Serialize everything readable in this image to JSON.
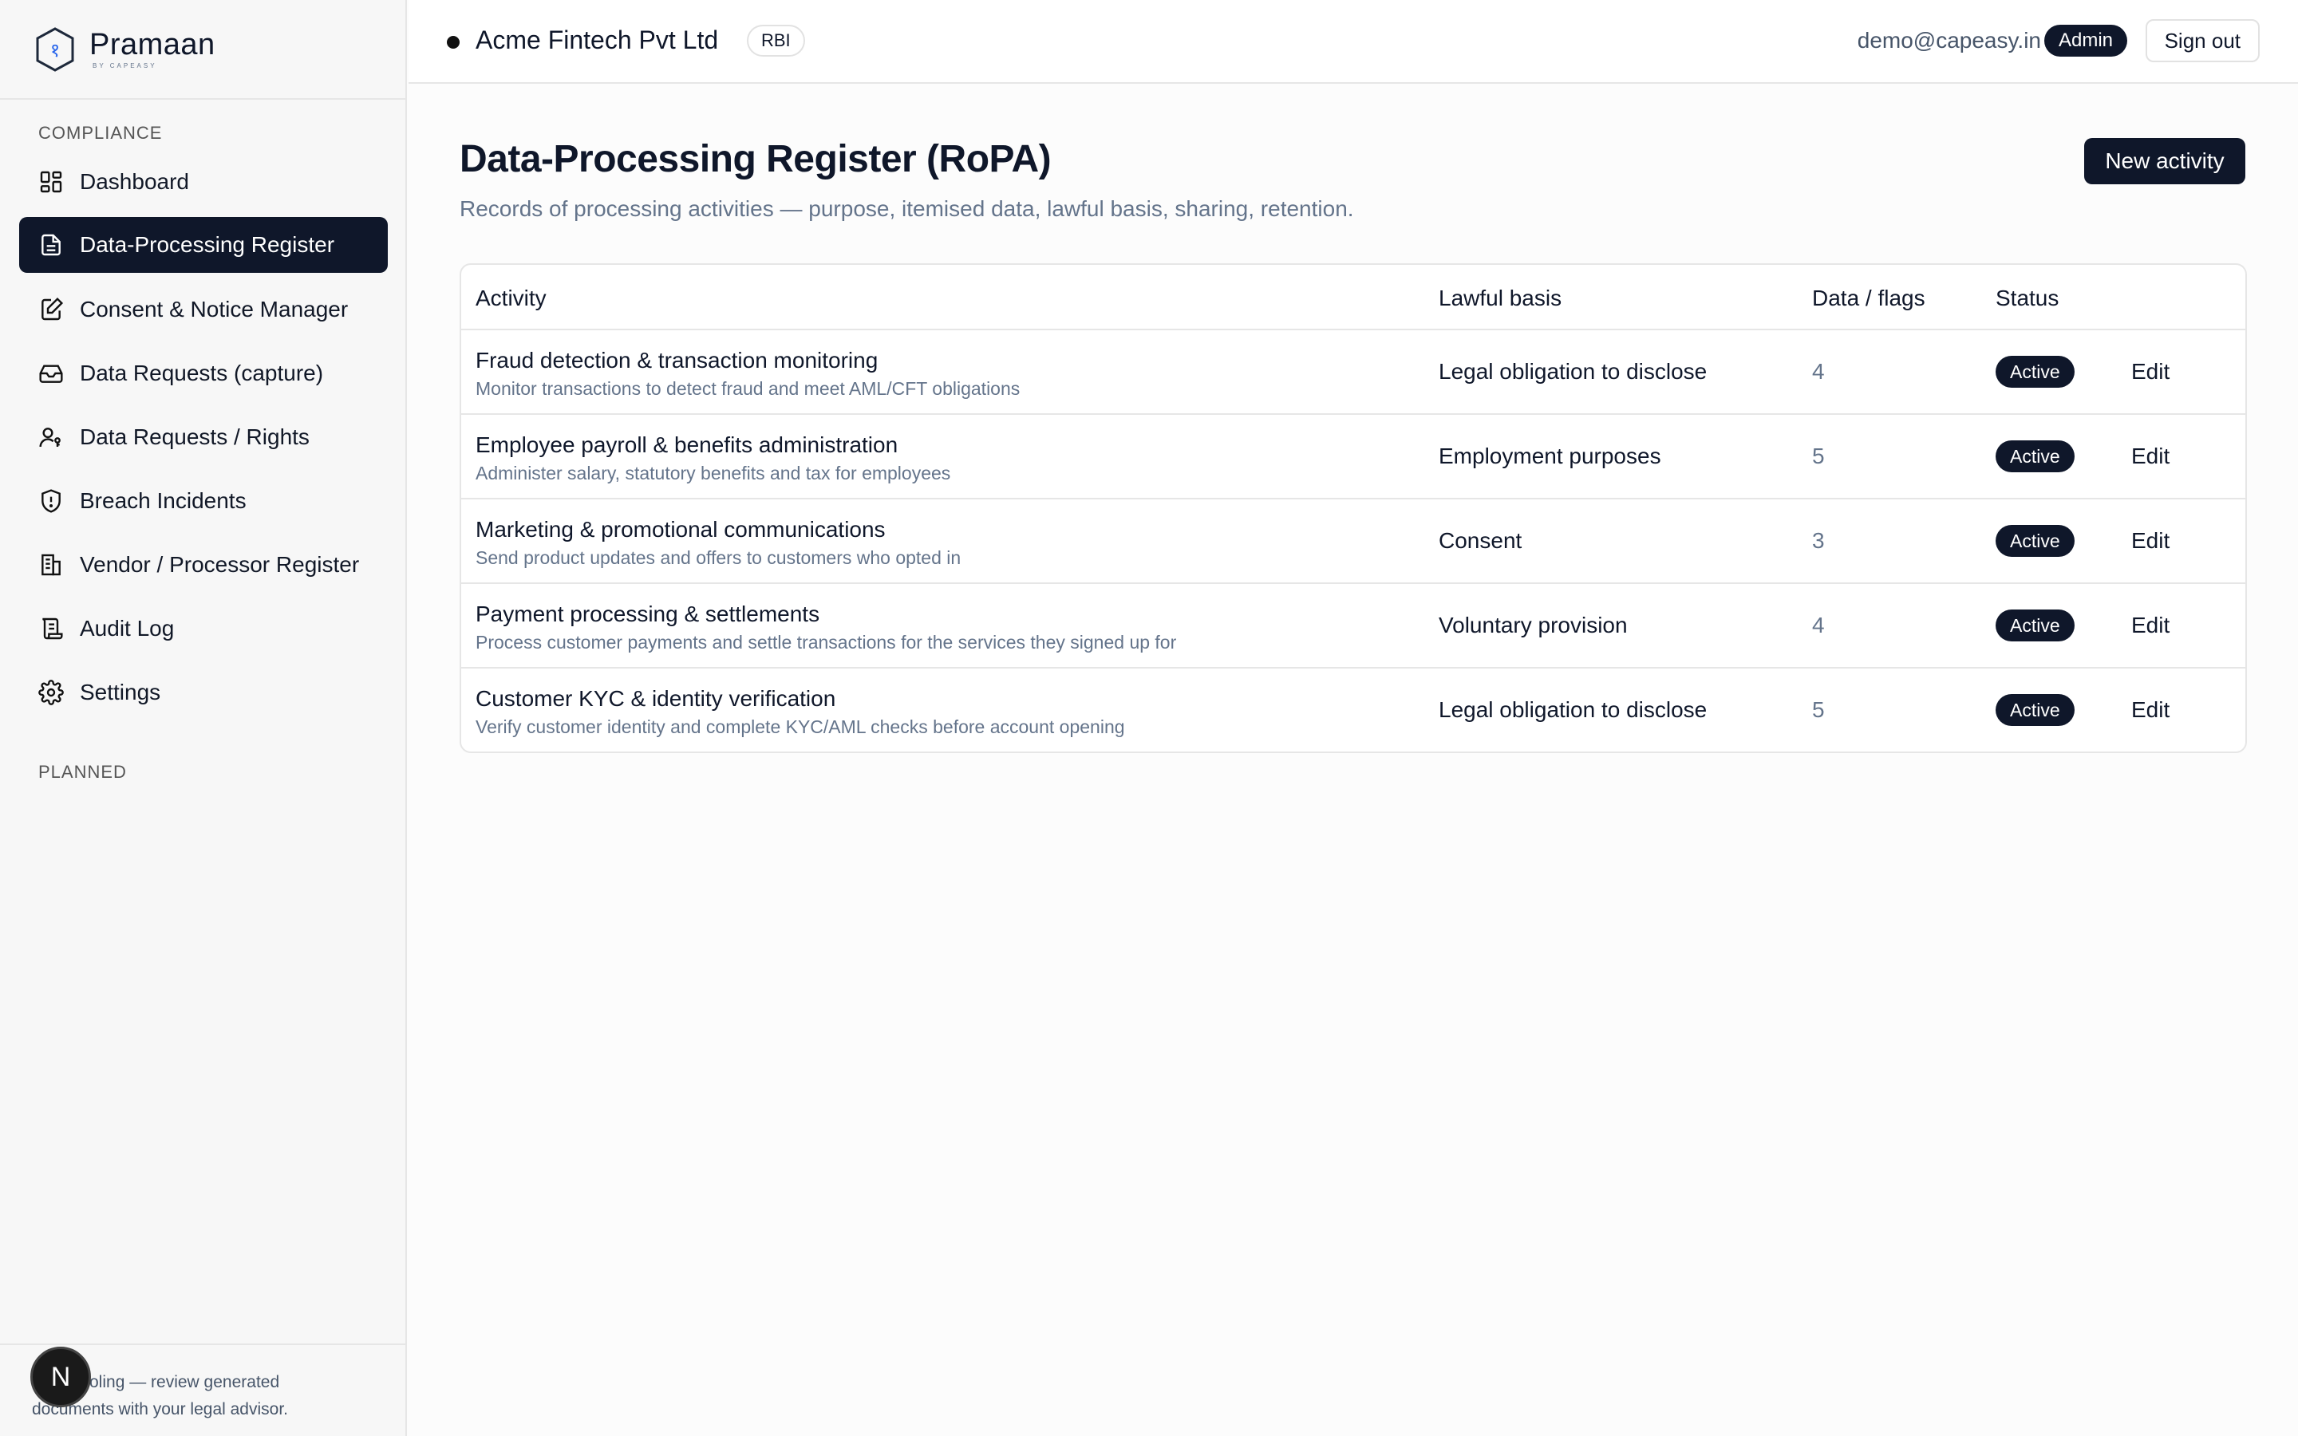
{
  "brand": {
    "name": "Pramaan",
    "sub": "BY CAPEASY",
    "logo_glyph": "१"
  },
  "sidebar": {
    "section_compliance": "COMPLIANCE",
    "section_planned": "PLANNED",
    "items": [
      {
        "label": "Dashboard",
        "icon": "dashboard-icon"
      },
      {
        "label": "Data-Processing Register",
        "icon": "document-icon"
      },
      {
        "label": "Consent & Notice Manager",
        "icon": "edit-document-icon"
      },
      {
        "label": "Data Requests (capture)",
        "icon": "inbox-icon"
      },
      {
        "label": "Data Requests / Rights",
        "icon": "user-key-icon"
      },
      {
        "label": "Breach Incidents",
        "icon": "shield-alert-icon"
      },
      {
        "label": "Vendor / Processor Register",
        "icon": "building-icon"
      },
      {
        "label": "Audit Log",
        "icon": "scroll-icon"
      },
      {
        "label": "Settings",
        "icon": "gear-icon"
      }
    ],
    "footer_line1": "oling — review generated",
    "footer_line2": "documents with your legal advisor.",
    "avatar_letter": "N"
  },
  "header": {
    "org_name": "Acme Fintech Pvt Ltd",
    "org_badge": "RBI",
    "user_email": "demo@capeasy.in",
    "role": "Admin",
    "sign_out": "Sign out"
  },
  "main": {
    "title": "Data-Processing Register (RoPA)",
    "subtitle": "Records of processing activities — purpose, itemised data, lawful basis, sharing, retention.",
    "new_button": "New activity",
    "columns": [
      "Activity",
      "Lawful basis",
      "Data / flags",
      "Status"
    ],
    "rows": [
      {
        "title": "Fraud detection & transaction monitoring",
        "desc": "Monitor transactions to detect fraud and meet AML/CFT obligations",
        "basis": "Legal obligation to disclose",
        "count": "4",
        "status": "Active",
        "action": "Edit"
      },
      {
        "title": "Employee payroll & benefits administration",
        "desc": "Administer salary, statutory benefits and tax for employees",
        "basis": "Employment purposes",
        "count": "5",
        "status": "Active",
        "action": "Edit"
      },
      {
        "title": "Marketing & promotional communications",
        "desc": "Send product updates and offers to customers who opted in",
        "basis": "Consent",
        "count": "3",
        "status": "Active",
        "action": "Edit"
      },
      {
        "title": "Payment processing & settlements",
        "desc": "Process customer payments and settle transactions for the services they signed up for",
        "basis": "Voluntary provision",
        "count": "4",
        "status": "Active",
        "action": "Edit"
      },
      {
        "title": "Customer KYC & identity verification",
        "desc": "Verify customer identity and complete KYC/AML checks before account opening",
        "basis": "Legal obligation to disclose",
        "count": "5",
        "status": "Active",
        "action": "Edit"
      }
    ]
  },
  "colors": {
    "primary": "#0f172a",
    "muted": "#64748b",
    "border": "#e6e6e6",
    "sidebar_bg": "#f7f7f7"
  }
}
